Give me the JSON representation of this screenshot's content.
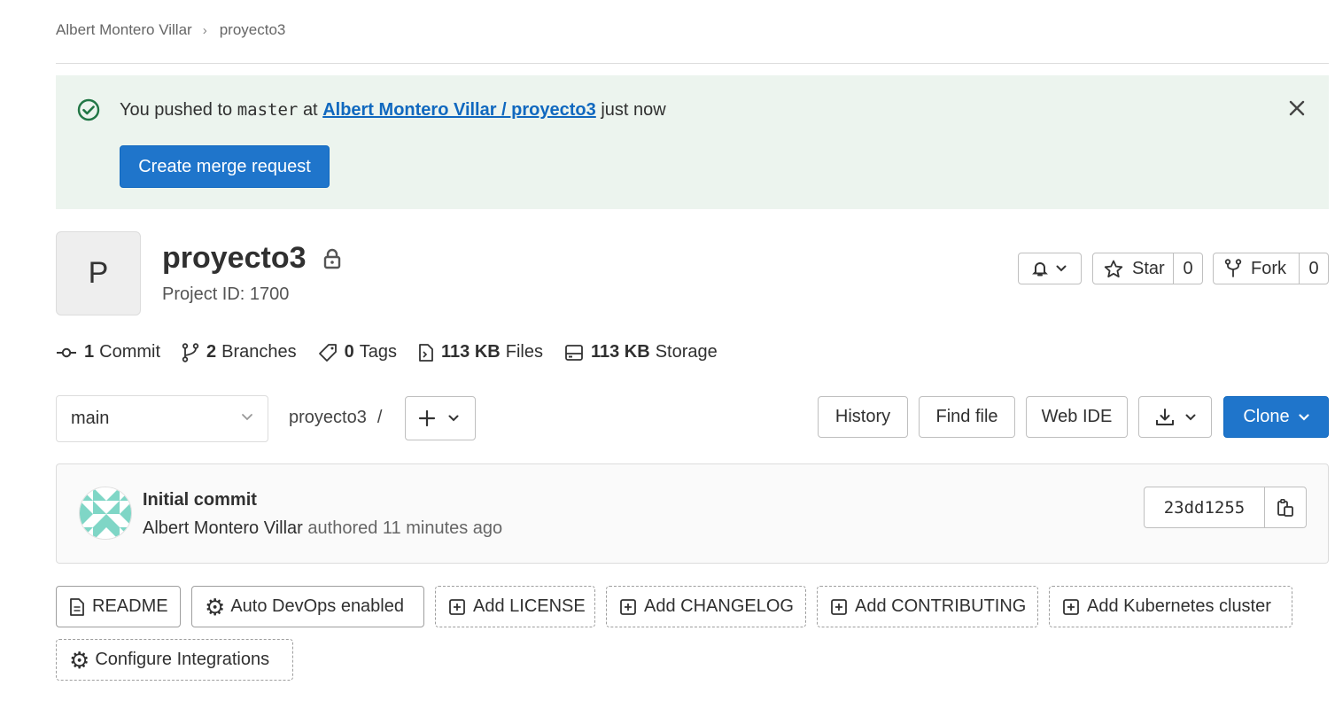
{
  "breadcrumb": {
    "owner": "Albert Montero Villar",
    "project": "proyecto3"
  },
  "alert": {
    "prefix": "You pushed to",
    "branch": "master",
    "at": "at",
    "link": "Albert Montero Villar / proyecto3",
    "suffix": "just now",
    "button": "Create merge request"
  },
  "project": {
    "avatar_letter": "P",
    "name": "proyecto3",
    "id_label": "Project ID: 1700"
  },
  "actions": {
    "star_label": "Star",
    "star_count": "0",
    "fork_label": "Fork",
    "fork_count": "0"
  },
  "stats": [
    {
      "num": "1",
      "label": "Commit"
    },
    {
      "num": "2",
      "label": "Branches"
    },
    {
      "num": "0",
      "label": "Tags"
    },
    {
      "num": "113 KB",
      "label": "Files"
    },
    {
      "num": "113 KB",
      "label": "Storage"
    }
  ],
  "toolbar": {
    "branch": "main",
    "path": "proyecto3",
    "path_sep": "/",
    "history": "History",
    "find_file": "Find file",
    "web_ide": "Web IDE",
    "clone": "Clone"
  },
  "commit": {
    "title": "Initial commit",
    "author": "Albert Montero Villar",
    "meta": "authored 11 minutes ago",
    "sha": "23dd1255"
  },
  "quick_actions": {
    "readme": "README",
    "autodevops": "Auto DevOps enabled",
    "license": "Add LICENSE",
    "changelog": "Add CHANGELOG",
    "contributing": "Add CONTRIBUTING",
    "kubernetes": "Add Kubernetes cluster",
    "integrations": "Configure Integrations"
  },
  "colors": {
    "primary": "#1f75cb",
    "alert_bg": "#ecf4ee",
    "success": "#217645",
    "link": "#1068bf"
  }
}
